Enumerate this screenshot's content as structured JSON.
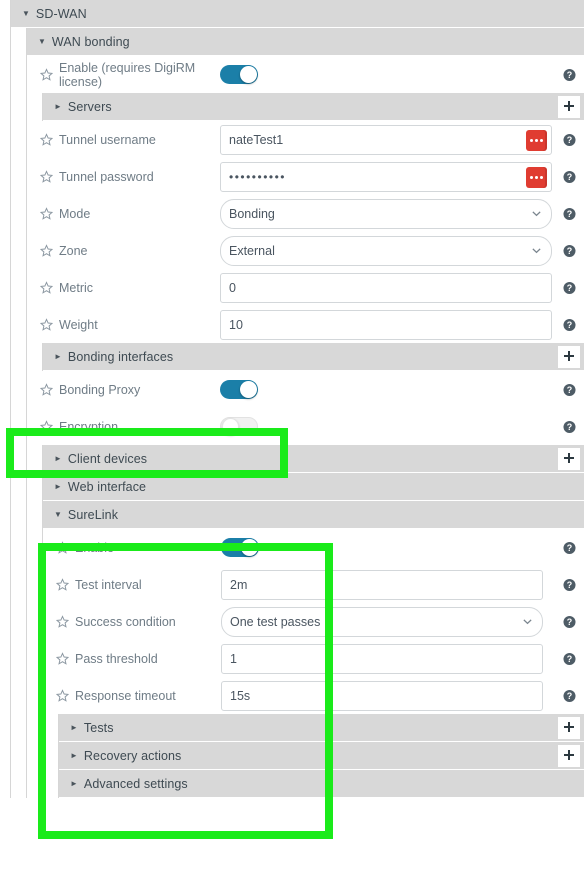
{
  "sections": {
    "sdwan": {
      "title": "SD-WAN",
      "caret": "▼"
    },
    "wan_bonding": {
      "title": "WAN bonding",
      "caret": "▼"
    },
    "servers": {
      "title": "Servers",
      "caret": "►",
      "add_label": "+"
    },
    "bonding_interfaces": {
      "title": "Bonding interfaces",
      "caret": "►",
      "add_label": "+"
    },
    "client_devices": {
      "title": "Client devices",
      "caret": "►",
      "add_label": "+"
    },
    "web_interface": {
      "title": "Web interface",
      "caret": "►"
    },
    "surelink": {
      "title": "SureLink",
      "caret": "▼"
    },
    "tests": {
      "title": "Tests",
      "caret": "►",
      "add_label": "+"
    },
    "recovery_actions": {
      "title": "Recovery actions",
      "caret": "►",
      "add_label": "+"
    },
    "advanced_settings": {
      "title": "Advanced settings",
      "caret": "►"
    }
  },
  "fields": {
    "enable_digirm": {
      "label": "Enable (requires DigiRM license)",
      "toggle": "on"
    },
    "tunnel_username": {
      "label": "Tunnel username",
      "value": "nateTest1"
    },
    "tunnel_password": {
      "label": "Tunnel password",
      "value": "••••••••••"
    },
    "mode": {
      "label": "Mode",
      "value": "Bonding"
    },
    "zone": {
      "label": "Zone",
      "value": "External"
    },
    "metric": {
      "label": "Metric",
      "value": "0"
    },
    "weight": {
      "label": "Weight",
      "value": "10"
    },
    "bonding_proxy": {
      "label": "Bonding Proxy",
      "toggle": "on"
    },
    "encryption": {
      "label": "Encryption",
      "toggle": "off"
    },
    "sl_enable": {
      "label": "Enable",
      "toggle": "on"
    },
    "sl_test_interval": {
      "label": "Test interval",
      "value": "2m"
    },
    "sl_success_condition": {
      "label": "Success condition",
      "value": "One test passes"
    },
    "sl_pass_threshold": {
      "label": "Pass threshold",
      "value": "1"
    },
    "sl_response_timeout": {
      "label": "Response timeout",
      "value": "15s"
    }
  },
  "icons": {
    "favorite": "star-icon",
    "help": "help-icon",
    "add": "plus-icon",
    "dropdown": "chevron-down-icon",
    "more": "ellipsis-icon"
  },
  "colors": {
    "toggle_on": "#1b7fa8",
    "section_header_bg": "#d8d8d8",
    "label_text": "#6f7c86",
    "red_button": "#e03c31",
    "highlight": "#1aeb1a"
  },
  "annotations": {
    "encryption_highlight": "Encryption",
    "surelink_highlight": "SureLink"
  }
}
